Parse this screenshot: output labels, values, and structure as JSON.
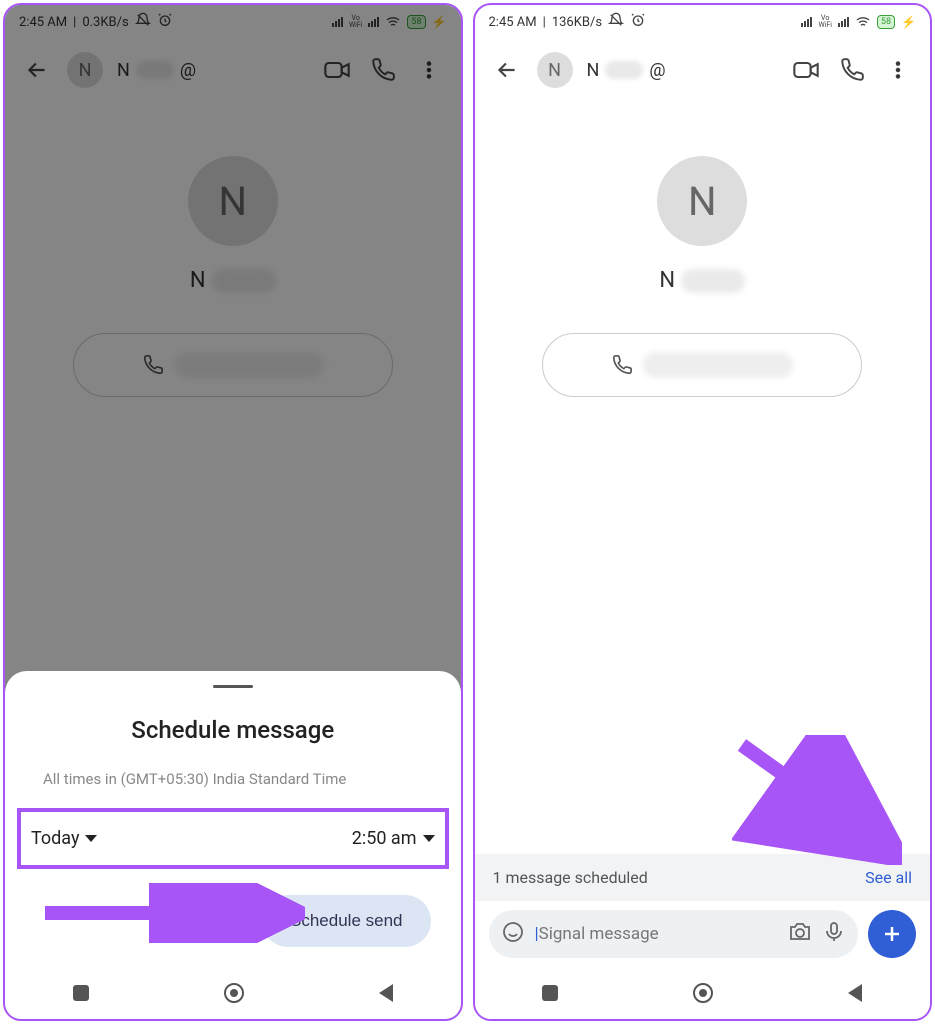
{
  "left": {
    "status": {
      "time": "2:45 AM",
      "speed": "0.3KB/s",
      "battery": "58"
    },
    "topbar": {
      "contact_initial": "N",
      "contact_prefix": "N",
      "at": "@"
    },
    "profile": {
      "initial": "N",
      "name_prefix": "N"
    },
    "sheet": {
      "title": "Schedule message",
      "subtitle": "All times in (GMT+05:30) India Standard Time",
      "date_label": "Today",
      "time_label": "2:50 am",
      "button": "Schedule send"
    }
  },
  "right": {
    "status": {
      "time": "2:45 AM",
      "speed": "136KB/s",
      "battery": "58"
    },
    "topbar": {
      "contact_initial": "N",
      "contact_prefix": "N",
      "at": "@"
    },
    "profile": {
      "initial": "N",
      "name_prefix": "N"
    },
    "banner": {
      "text": "1 message scheduled",
      "link": "See all"
    },
    "composer": {
      "placeholder": "Signal message"
    }
  }
}
